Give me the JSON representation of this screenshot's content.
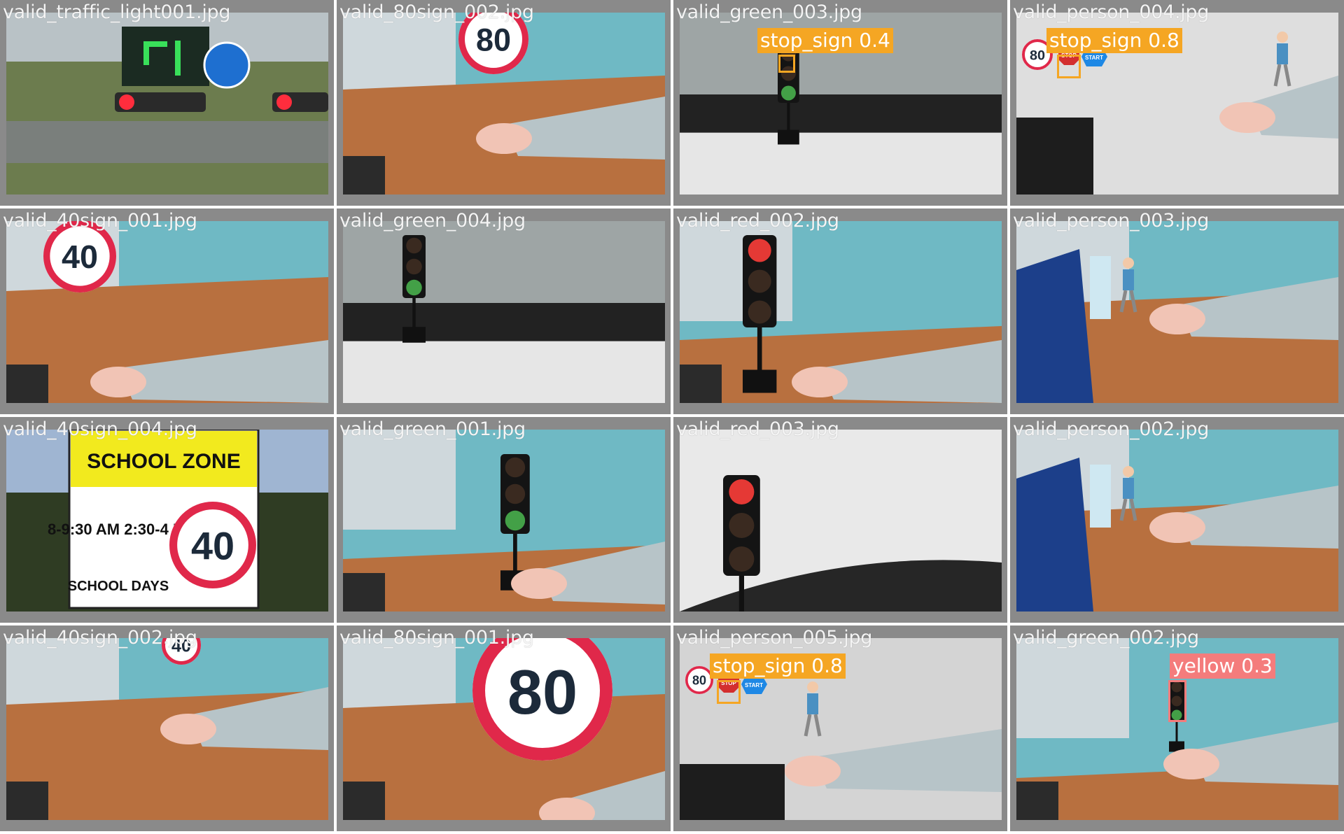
{
  "tiles": [
    {
      "file": "valid_traffic_light001.jpg",
      "scene": "street"
    },
    {
      "file": "valid_80sign_002.jpg",
      "scene": "desk80"
    },
    {
      "file": "valid_green_003.jpg",
      "scene": "floorlight",
      "det": "stop_sign 0.4",
      "det_color": "#f5a623"
    },
    {
      "file": "valid_person_004.jpg",
      "scene": "person",
      "det": "stop_sign 0.8",
      "det_color": "#f5a623"
    },
    {
      "file": "valid_40sign_001.jpg",
      "scene": "desk40"
    },
    {
      "file": "valid_green_004.jpg",
      "scene": "floorlight2"
    },
    {
      "file": "valid_red_002.jpg",
      "scene": "redlight"
    },
    {
      "file": "valid_person_003.jpg",
      "scene": "tablet"
    },
    {
      "file": "valid_40sign_004.jpg",
      "scene": "school"
    },
    {
      "file": "valid_green_001.jpg",
      "scene": "deskgreen"
    },
    {
      "file": "valid_red_003.jpg",
      "scene": "redlight2"
    },
    {
      "file": "valid_person_002.jpg",
      "scene": "tablet"
    },
    {
      "file": "valid_40sign_002.jpg",
      "scene": "desk40b"
    },
    {
      "file": "valid_80sign_001.jpg",
      "scene": "big80"
    },
    {
      "file": "valid_person_005.jpg",
      "scene": "person2",
      "det": "stop_sign 0.8",
      "det_color": "#f5a623"
    },
    {
      "file": "valid_green_002.jpg",
      "scene": "deskyellow",
      "det": "yellow 0.3",
      "det_color": "#f47c7c"
    }
  ],
  "signs": {
    "sign80": "80",
    "sign40": "40",
    "school_zone": "SCHOOL ZONE",
    "school_times": "8-9:30 AM 2:30-4 PM",
    "school_days": "SCHOOL DAYS",
    "stop": "STOP",
    "start": "START"
  }
}
